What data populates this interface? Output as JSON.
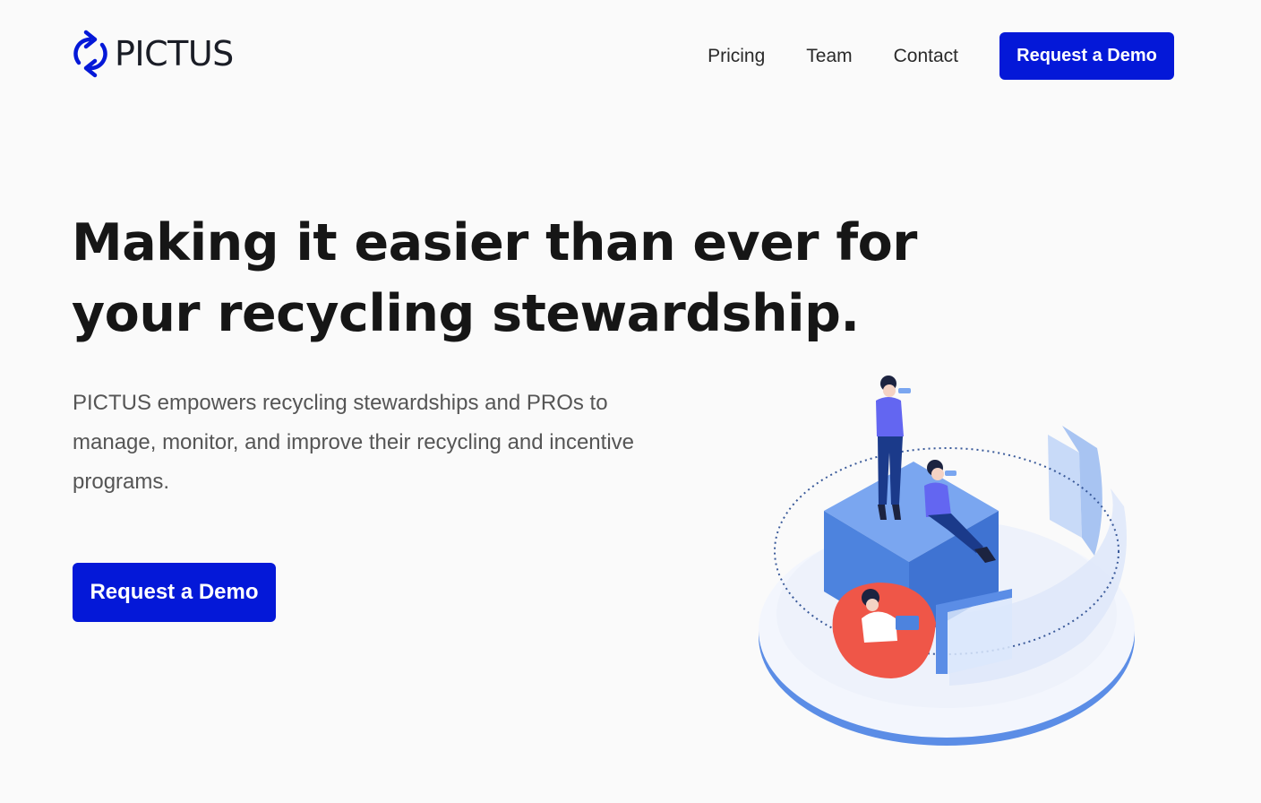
{
  "header": {
    "logo_text": "PICTUS",
    "logo_icon": "recycle-arrows-icon",
    "nav": [
      {
        "label": "Pricing"
      },
      {
        "label": "Team"
      },
      {
        "label": "Contact"
      }
    ],
    "cta_label": "Request a Demo"
  },
  "hero": {
    "title": "Making it easier than ever for your recycling stewardship.",
    "subtitle": "PICTUS empowers recycling stewardships and PROs to manage, monitor, and improve their recycling and incentive programs.",
    "cta_label": "Request a Demo"
  },
  "colors": {
    "accent": "#0418d8",
    "background": "#fafafa",
    "illustration_blue": "#5b8de6",
    "illustration_red": "#ef5648"
  }
}
